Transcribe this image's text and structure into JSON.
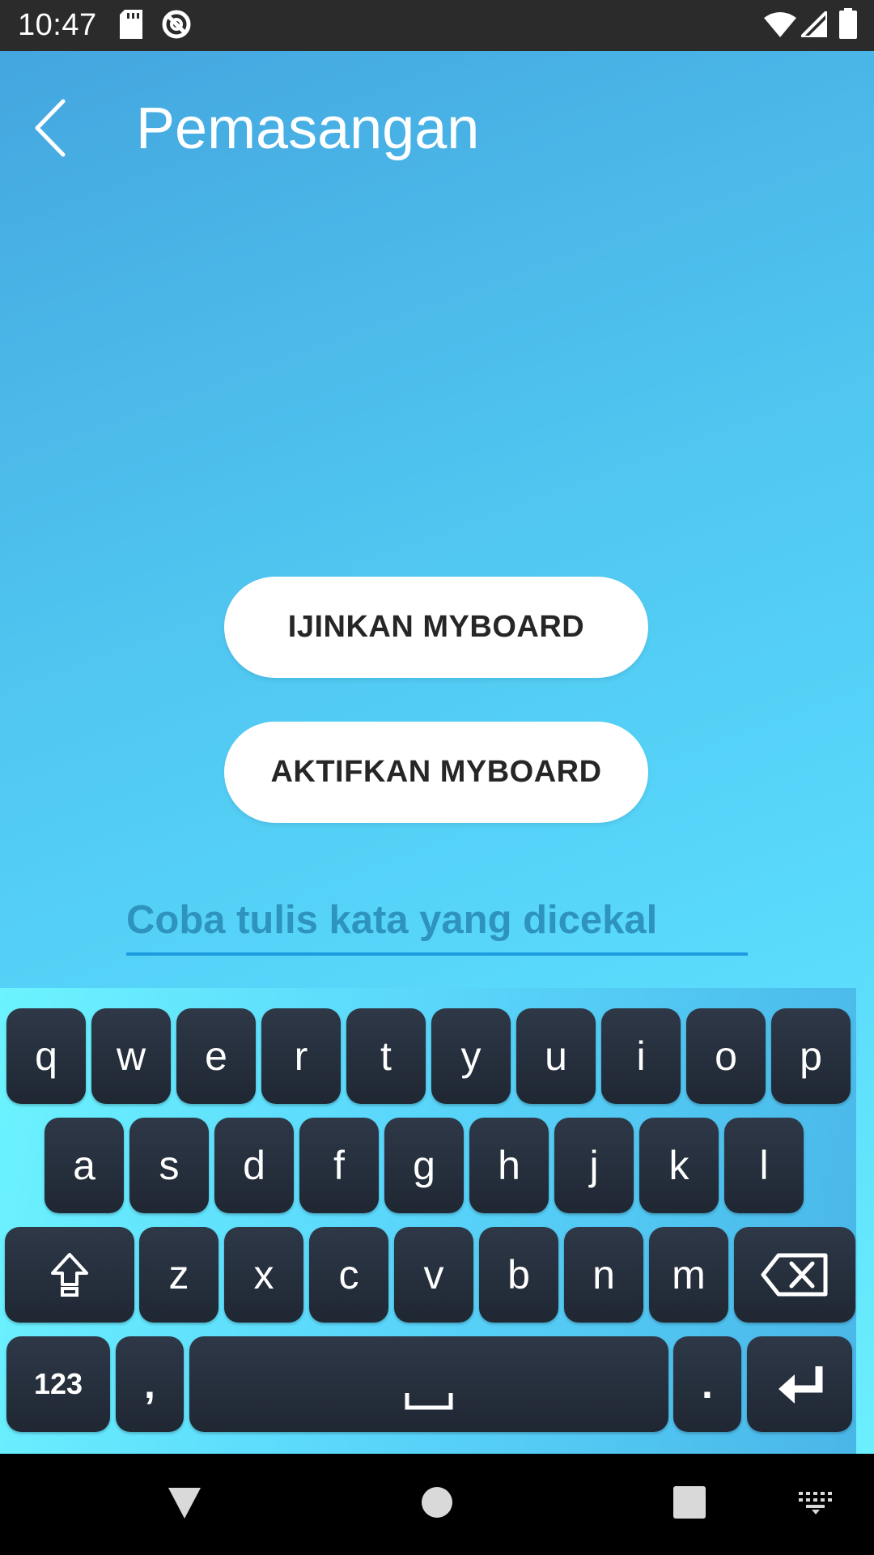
{
  "status_bar": {
    "time": "10:47",
    "icons": [
      "sd-card-icon",
      "no-sync-icon",
      "wifi-icon",
      "signal-icon",
      "battery-icon"
    ]
  },
  "header": {
    "title": "Pemasangan",
    "back_icon": "chevron-left-icon"
  },
  "main": {
    "allow_button_label": "IJINKAN MYBOARD",
    "activate_button_label": "AKTIFKAN MYBOARD",
    "test_input_placeholder": "Coba tulis kata yang dicekal",
    "test_input_value": ""
  },
  "keyboard": {
    "row1": [
      "q",
      "w",
      "e",
      "r",
      "t",
      "y",
      "u",
      "i",
      "o",
      "p"
    ],
    "row2": [
      "a",
      "s",
      "d",
      "f",
      "g",
      "h",
      "j",
      "k",
      "l"
    ],
    "row3": [
      "z",
      "x",
      "c",
      "v",
      "b",
      "n",
      "m"
    ],
    "numbers_key": "123",
    "comma_key": ",",
    "period_key": ".",
    "shift_icon": "shift-icon",
    "backspace_icon": "backspace-icon",
    "space_icon": "space-bar-icon",
    "enter_icon": "enter-icon"
  },
  "nav_bar": {
    "icons": [
      "back-triangle-icon",
      "home-circle-icon",
      "recents-square-icon",
      "keyboard-switch-icon"
    ]
  },
  "colors": {
    "status_bar": "#2b2b2b",
    "gradient_top": "#44a6df",
    "gradient_bottom": "#6cefff",
    "key_bg": "#252e3b",
    "input_underline": "#1d9be0",
    "placeholder_text": "#2e93bf"
  }
}
